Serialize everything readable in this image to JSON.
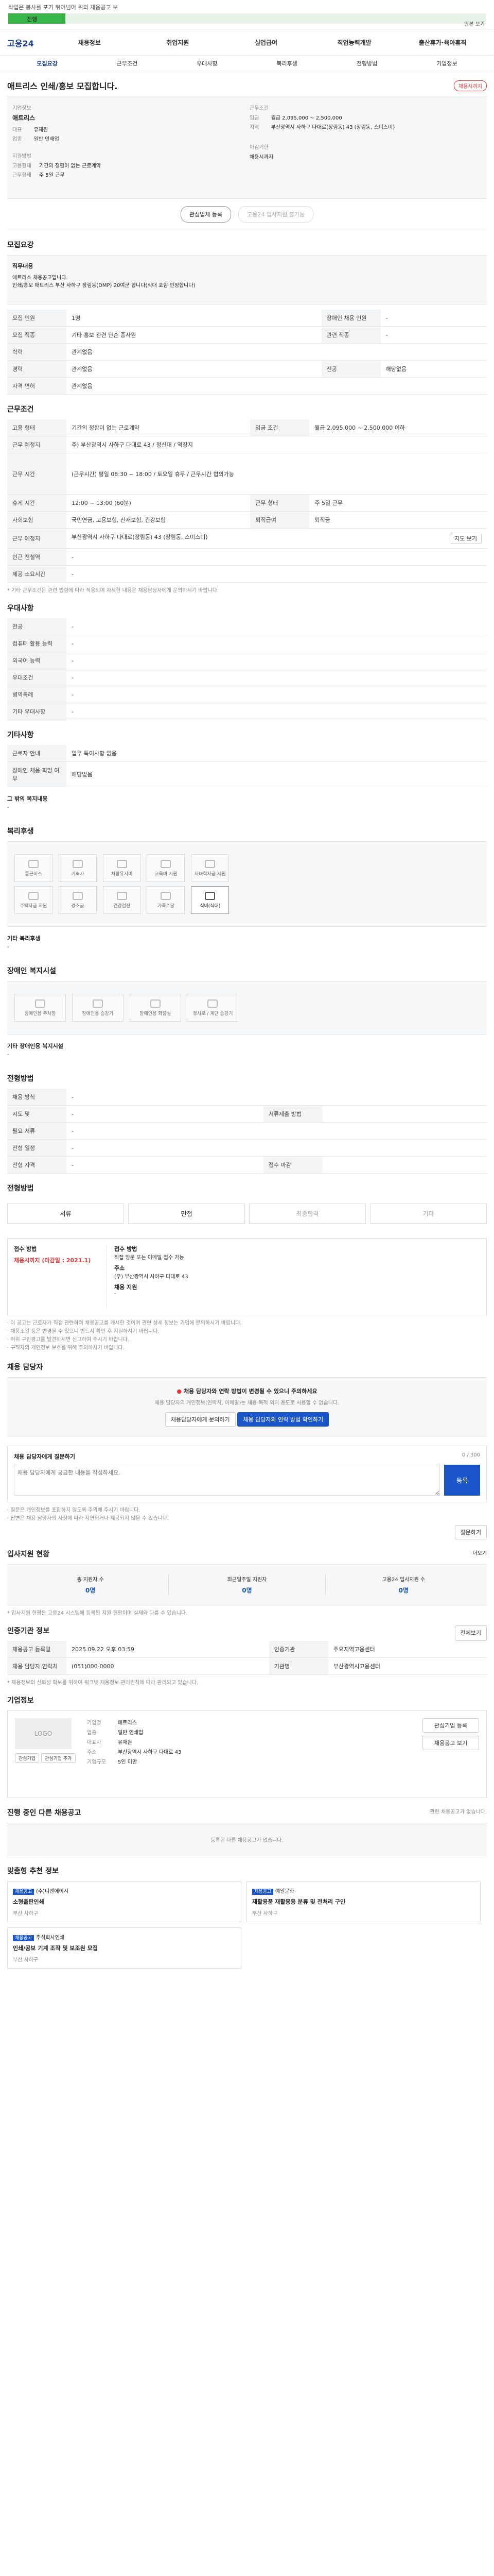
{
  "banner": {
    "text": "작업은 봉사를 포기 뛰어넘어 위의 채용공고 보",
    "progress_label": "진행",
    "progress_pct": 12,
    "link": "원본 보기"
  },
  "gnb": {
    "logo": "고용24",
    "menu": [
      "채용정보",
      "취업지원",
      "실업급여",
      "직업능력개발",
      "출산휴가·육아휴직"
    ]
  },
  "subtabs": [
    "모집요강",
    "근무조건",
    "우대사항",
    "복리후생",
    "전형방법",
    "기업정보"
  ],
  "header": {
    "title": "애트리스 인쇄/홍보 모집합니다.",
    "badge": "채용시까지",
    "company_label": "기업정보",
    "company_name": "애트리스",
    "company_rows": [
      {
        "k": "대표",
        "v": "유재원"
      },
      {
        "k": "업종",
        "v": "일반 인쇄업"
      }
    ],
    "cond_label": "근무조건",
    "cond_rows": [
      {
        "k": "임금",
        "v": "월급 2,095,000 ~ 2,500,000"
      },
      {
        "k": "지역",
        "v": "부산광역시 사하구 다대로(장림동) 43 (장림동, 스미스미)"
      }
    ],
    "apply_label": "지원방법",
    "apply_rows": [
      {
        "k": "고용형태",
        "v": "기간의 정함이 없는 근로계약"
      },
      {
        "k": "근무형태",
        "v": "주 5일 근무"
      }
    ],
    "deadline_label": "마감기한",
    "deadline": "채용시까지"
  },
  "actions": {
    "scrap": "관심업체 등록",
    "apply": "고용24 입사지원 불가능"
  },
  "recruit": {
    "title": "모집요강",
    "desc_head": "직무내용",
    "desc": [
      "애트리스 채용공고입니다.",
      "인쇄/홍보 애트리스 부산 사하구 장림동(DMP) 20여군 합니다(식대 포함 인정합니다)"
    ],
    "rows": [
      [
        "모집 인원",
        "1명",
        "장애인 채용 인원",
        "-"
      ],
      [
        "모집 직종",
        "기타 홍보 관련 단순 종사원",
        "관련 직종",
        "-"
      ],
      [
        "학력",
        "관계없음",
        "",
        ""
      ],
      [
        "경력",
        "관계없음",
        "전공",
        "해당없음"
      ],
      [
        "자격 면허",
        "관계없음",
        "",
        ""
      ]
    ]
  },
  "cond": {
    "title": "근무조건",
    "rows": [
      [
        "고용 형태",
        "기간의 정함이 없는 근로계약",
        "임금 조건",
        "월급 2,095,000 ~ 2,500,000 이하"
      ],
      [
        "근무 예정지",
        "주) 부산광역시 사하구 다대로 43 / 정신대 / 역장지",
        "",
        ""
      ],
      [
        "근무 시간",
        "(근무시간) 평일 08:30 ~ 18:00 / 토요일 휴무 / 근무시간 협의가능",
        "",
        ""
      ],
      [
        "휴게 시간",
        "12:00 ~ 13:00 (60분)",
        "근무 형태",
        "주 5일 근무"
      ],
      [
        "사회보험",
        "국민연금, 고용보험, 산재보험, 건강보험",
        "퇴직급여",
        "퇴직금"
      ],
      [
        "근무 예정지",
        "부산광역시 사하구 다대로(장림동) 43 (장림동, 스미스미)",
        "",
        ""
      ],
      [
        "인근 전철역",
        "-",
        "",
        ""
      ],
      [
        "제공 소요시간",
        "-",
        "",
        ""
      ]
    ],
    "map_btn": "지도 보기",
    "note": "* 기타 근무조건은 관련 법령에 따라 적용되며 자세한 내용은 채용담당자에게 문의하시기 바랍니다."
  },
  "pref": {
    "title": "우대사항",
    "rows": [
      [
        "전공",
        "-"
      ],
      [
        "컴퓨터 활용 능력",
        "-"
      ],
      [
        "외국어 능력",
        "-"
      ],
      [
        "우대조건",
        "-"
      ],
      [
        "병역특례",
        "-"
      ],
      [
        "기타 우대사항",
        "-"
      ]
    ]
  },
  "other": {
    "title": "기타사항",
    "rows": [
      [
        "근로자 안내",
        "업무 특이사항 없음"
      ],
      [
        "장애인 채용 희망 여부",
        "해당없음"
      ]
    ],
    "extra_head": "그 밖의 복지내용",
    "extra": "-"
  },
  "welfare": {
    "title": "복리후생",
    "tiles": [
      "통근버스",
      "기숙사",
      "차량유지비",
      "교육비 지원",
      "자녀학자금 지원",
      "주택자금 지원",
      "경조금",
      "건강검진",
      "가족수당",
      "식비(식대)"
    ],
    "on_index": 9,
    "other_head": "기타 복리후생",
    "other": "-"
  },
  "disabled": {
    "title": "장애인 복지시설",
    "tiles": [
      "장애인용 주차장",
      "장애인용 승강기",
      "장애인용 화장실",
      "경사로 / 계단 승강기"
    ],
    "other_head": "기타 장애인용 복지시설",
    "other": "-"
  },
  "process": {
    "title": "전형방법",
    "rows": [
      [
        "채용 방식",
        "-",
        "",
        ""
      ],
      [
        "지도 및",
        "-",
        "",
        "서류제출 방법"
      ],
      [
        "필요 서류",
        "-",
        "",
        ""
      ],
      [
        "전형 일정",
        "-",
        "",
        ""
      ],
      [
        "전형 자격",
        "-",
        "접수 마감",
        ""
      ]
    ]
  },
  "steps": {
    "title": "전형방법",
    "items": [
      "서류",
      "면접",
      "최종합격",
      "기타"
    ]
  },
  "apply": {
    "title": "접수 방법",
    "method": "채용시까지 (마감일 : 2021.1)",
    "how_head": "접수 방법",
    "how": "직접 방문 또는 이메일 접수 가능",
    "addr_head": "주소",
    "addr": "(우) 부산광역시 사하구 다대로 43",
    "tel_head": "채용 지원",
    "tel": "-",
    "notes": [
      "· 이 공고는 근로자가 직접 관련하여 채용공고를 게시한 것이며 관련 상세 정보는 기업에 문의하시기 바랍니다.",
      "· 채용조건 등은 변경될 수 있으니 반드시 확인 후 지원하시기 바랍니다.",
      "· 허위 구인광고를 발견하시면 신고하여 주시기 바랍니다.",
      "· 구직자의 개인정보 보호를 위해 주의하시기 바랍니다."
    ]
  },
  "contact": {
    "title": "채용 담당자",
    "warn": "채용 담당자와 연락 방법이 변경될 수 있으니 주의하세요",
    "warn_sub": "채용 담당자의 개인정보(연락처, 이메일)는 채용 목적 외의 용도로 사용할 수 없습니다.",
    "btn1": "채용담당자에게 문의하기",
    "btn2": "채용 담당자와 연락 방법 확인하기"
  },
  "qna": {
    "title": "채용 담당자에게 질문하기",
    "count": "0 / 300",
    "placeholder": "채용 담당자에게 궁금한 내용을 작성하세요.",
    "submit": "등록",
    "notes": [
      "· 질문은 개인정보를 포함하지 않도록 주의해 주시기 바랍니다.",
      "· 답변은 채용 담당자의 사정에 따라 지연되거나 제공되지 않을 수 있습니다."
    ],
    "link": "질문하기"
  },
  "stats": {
    "title": "입사지원 현황",
    "more": "더보기",
    "items": [
      {
        "label": "총 지원자 수",
        "value": "0명"
      },
      {
        "label": "최근일주일 지원자",
        "value": "0명"
      },
      {
        "label": "고용24 입사지원 수",
        "value": "0명"
      }
    ],
    "note": "* 입사지원 현황은 고용24 시스템에 등록된 지원 현황이며 실제와 다를 수 있습니다."
  },
  "manager": {
    "title": "인증기관 정보",
    "more": "전체보기",
    "rows": [
      [
        "채용공고 등록일",
        "2025.09.22 오후 03:59",
        "인증기관",
        "주요지역고용센터"
      ],
      [
        "채용 담당자 연락처",
        "(051)000-0000",
        "기관명",
        "부산광역시고용센터"
      ]
    ],
    "note": "* 채용정보의 신뢰성 확보를 위하여 워크넷 채용정보 관리원칙에 따라 관리되고 있습니다."
  },
  "company": {
    "title": "기업정보",
    "logo": "LOGO",
    "fav": "관심기업",
    "follow": "관심기업 추가",
    "rows": [
      [
        "기업명",
        "애트리스"
      ],
      [
        "업종",
        "일반 인쇄업"
      ],
      [
        "대표자",
        "유재원"
      ],
      [
        "주소",
        "부산광역시 사하구 다대로 43"
      ],
      [
        "기업규모",
        "5인 미만"
      ]
    ],
    "sbtn1": "관심기업 등록",
    "sbtn2": "채용공고 보기"
  },
  "related": {
    "title": "진행 중인 다른 채용공고",
    "sub": "관련 채용공고가 없습니다.",
    "empty": "등록된 다른 채용공고가 없습니다."
  },
  "recommend": {
    "title": "맞춤형 추천 정보",
    "items": [
      {
        "tag": "채용공고",
        "company": "(주)디앤에이시",
        "title": "소형출판인쇄",
        "meta": "부산 사하구"
      },
      {
        "tag": "채용공고",
        "company": "예일문화",
        "title": "재활용품 재활용용 분류 및 전처리 구인",
        "meta": "부산 사하구"
      },
      {
        "tag": "채용공고",
        "company": "주식회사인쇄",
        "title": "인쇄/공보 기계 조작 및 보조원 모집",
        "meta": "부산 사하구"
      }
    ]
  }
}
